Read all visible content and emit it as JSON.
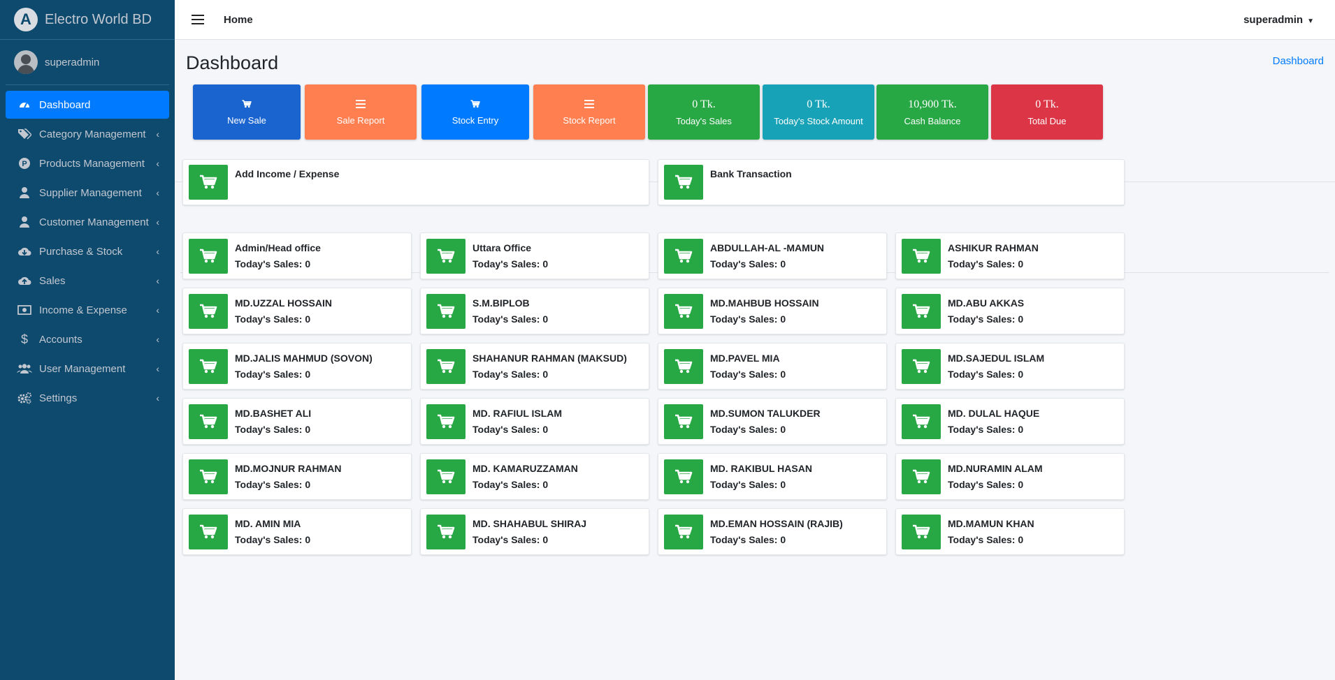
{
  "brand": {
    "name": "Electro World BD",
    "logo_letter": "A"
  },
  "user": {
    "name": "superadmin"
  },
  "sidebar": {
    "items": [
      {
        "label": "Dashboard",
        "icon": "dashboard-icon",
        "active": true
      },
      {
        "label": "Category Management",
        "icon": "tags-icon"
      },
      {
        "label": "Products Management",
        "icon": "product-p-icon"
      },
      {
        "label": "Supplier Management",
        "icon": "user-icon"
      },
      {
        "label": "Customer Management",
        "icon": "user-icon"
      },
      {
        "label": "Purchase & Stock",
        "icon": "cloud-download-icon"
      },
      {
        "label": "Sales",
        "icon": "cloud-upload-icon"
      },
      {
        "label": "Income & Expense",
        "icon": "money-icon"
      },
      {
        "label": "Accounts",
        "icon": "dollar-icon"
      },
      {
        "label": "User Management",
        "icon": "users-icon"
      },
      {
        "label": "Settings",
        "icon": "cogs-icon"
      }
    ],
    "arrow": "‹"
  },
  "header": {
    "home": "Home",
    "user_menu": "superadmin",
    "caret": "▼"
  },
  "page": {
    "title": "Dashboard",
    "breadcrumb": "Dashboard"
  },
  "stats": [
    {
      "label": "New Sale",
      "icon": "cart-icon",
      "color": "#1a64d0"
    },
    {
      "label": "Sale Report",
      "icon": "bars-icon",
      "color": "#ff7f50"
    },
    {
      "label": "Stock Entry",
      "icon": "cart-icon",
      "color": "#007bff"
    },
    {
      "label": "Stock Report",
      "icon": "bars-icon",
      "color": "#ff7f50"
    },
    {
      "value": "0 Tk.",
      "label": "Today's Sales",
      "color": "#28a745"
    },
    {
      "value": "0 Tk.",
      "label": "Today's Stock Amount",
      "color": "#17a2b8"
    },
    {
      "value": "10,900 Tk.",
      "label": "Cash Balance",
      "color": "#28a745"
    },
    {
      "value": "0 Tk.",
      "label": "Total Due",
      "color": "#dc3545"
    }
  ],
  "actions": [
    {
      "title": "Add Income / Expense"
    },
    {
      "title": "Bank Transaction"
    }
  ],
  "sales_prefix": "Today's Sales:",
  "branches": [
    {
      "name": "Admin/Head office",
      "sales": "0"
    },
    {
      "name": "Uttara Office",
      "sales": "0"
    },
    {
      "name": "ABDULLAH-AL -MAMUN",
      "sales": "0"
    },
    {
      "name": "ASHIKUR RAHMAN",
      "sales": "0"
    },
    {
      "name": "MD.UZZAL HOSSAIN",
      "sales": "0"
    },
    {
      "name": "S.M.BIPLOB",
      "sales": "0"
    },
    {
      "name": "MD.MAHBUB HOSSAIN",
      "sales": "0"
    },
    {
      "name": "MD.ABU AKKAS",
      "sales": "0"
    },
    {
      "name": "MD.JALIS MAHMUD (SOVON)",
      "sales": "0"
    },
    {
      "name": "SHAHANUR RAHMAN (MAKSUD)",
      "sales": "0"
    },
    {
      "name": "MD.PAVEL MIA",
      "sales": "0"
    },
    {
      "name": "MD.SAJEDUL ISLAM",
      "sales": "0"
    },
    {
      "name": "MD.BASHET ALI",
      "sales": "0"
    },
    {
      "name": "MD. RAFIUL ISLAM",
      "sales": "0"
    },
    {
      "name": "MD.SUMON TALUKDER",
      "sales": "0"
    },
    {
      "name": "MD. DULAL HAQUE",
      "sales": "0"
    },
    {
      "name": "MD.MOJNUR RAHMAN",
      "sales": "0"
    },
    {
      "name": "MD. KAMARUZZAMAN",
      "sales": "0"
    },
    {
      "name": "MD. RAKIBUL HASAN",
      "sales": "0"
    },
    {
      "name": "MD.NURAMIN ALAM",
      "sales": "0"
    },
    {
      "name": "MD. AMIN MIA",
      "sales": "0"
    },
    {
      "name": "MD. SHAHABUL SHIRAJ",
      "sales": "0"
    },
    {
      "name": "MD.EMAN HOSSAIN (RAJIB)",
      "sales": "0"
    },
    {
      "name": "MD.MAMUN KHAN",
      "sales": "0"
    }
  ]
}
